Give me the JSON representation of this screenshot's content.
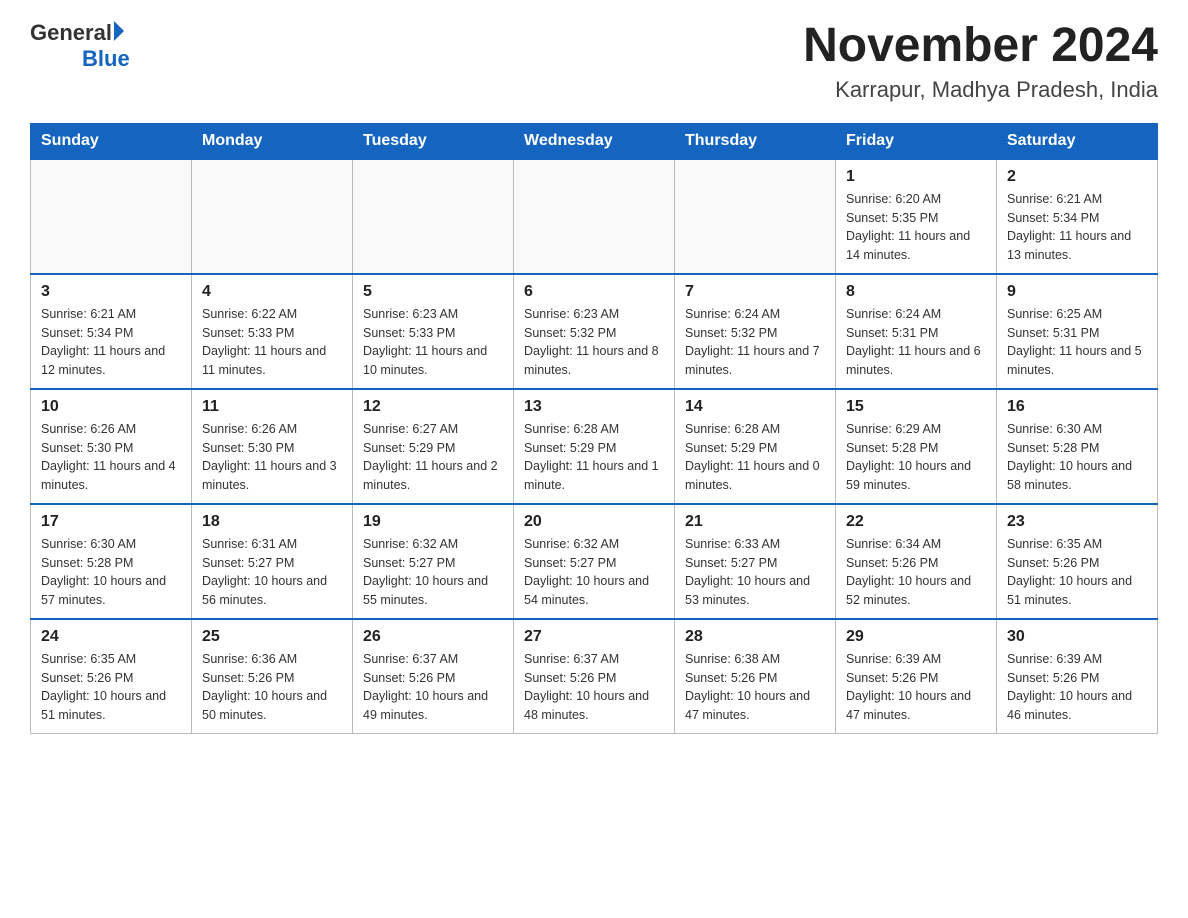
{
  "header": {
    "logo_general": "General",
    "logo_blue": "Blue",
    "month_title": "November 2024",
    "location": "Karrapur, Madhya Pradesh, India"
  },
  "days_of_week": [
    "Sunday",
    "Monday",
    "Tuesday",
    "Wednesday",
    "Thursday",
    "Friday",
    "Saturday"
  ],
  "weeks": [
    [
      {
        "day": "",
        "info": ""
      },
      {
        "day": "",
        "info": ""
      },
      {
        "day": "",
        "info": ""
      },
      {
        "day": "",
        "info": ""
      },
      {
        "day": "",
        "info": ""
      },
      {
        "day": "1",
        "info": "Sunrise: 6:20 AM\nSunset: 5:35 PM\nDaylight: 11 hours and 14 minutes."
      },
      {
        "day": "2",
        "info": "Sunrise: 6:21 AM\nSunset: 5:34 PM\nDaylight: 11 hours and 13 minutes."
      }
    ],
    [
      {
        "day": "3",
        "info": "Sunrise: 6:21 AM\nSunset: 5:34 PM\nDaylight: 11 hours and 12 minutes."
      },
      {
        "day": "4",
        "info": "Sunrise: 6:22 AM\nSunset: 5:33 PM\nDaylight: 11 hours and 11 minutes."
      },
      {
        "day": "5",
        "info": "Sunrise: 6:23 AM\nSunset: 5:33 PM\nDaylight: 11 hours and 10 minutes."
      },
      {
        "day": "6",
        "info": "Sunrise: 6:23 AM\nSunset: 5:32 PM\nDaylight: 11 hours and 8 minutes."
      },
      {
        "day": "7",
        "info": "Sunrise: 6:24 AM\nSunset: 5:32 PM\nDaylight: 11 hours and 7 minutes."
      },
      {
        "day": "8",
        "info": "Sunrise: 6:24 AM\nSunset: 5:31 PM\nDaylight: 11 hours and 6 minutes."
      },
      {
        "day": "9",
        "info": "Sunrise: 6:25 AM\nSunset: 5:31 PM\nDaylight: 11 hours and 5 minutes."
      }
    ],
    [
      {
        "day": "10",
        "info": "Sunrise: 6:26 AM\nSunset: 5:30 PM\nDaylight: 11 hours and 4 minutes."
      },
      {
        "day": "11",
        "info": "Sunrise: 6:26 AM\nSunset: 5:30 PM\nDaylight: 11 hours and 3 minutes."
      },
      {
        "day": "12",
        "info": "Sunrise: 6:27 AM\nSunset: 5:29 PM\nDaylight: 11 hours and 2 minutes."
      },
      {
        "day": "13",
        "info": "Sunrise: 6:28 AM\nSunset: 5:29 PM\nDaylight: 11 hours and 1 minute."
      },
      {
        "day": "14",
        "info": "Sunrise: 6:28 AM\nSunset: 5:29 PM\nDaylight: 11 hours and 0 minutes."
      },
      {
        "day": "15",
        "info": "Sunrise: 6:29 AM\nSunset: 5:28 PM\nDaylight: 10 hours and 59 minutes."
      },
      {
        "day": "16",
        "info": "Sunrise: 6:30 AM\nSunset: 5:28 PM\nDaylight: 10 hours and 58 minutes."
      }
    ],
    [
      {
        "day": "17",
        "info": "Sunrise: 6:30 AM\nSunset: 5:28 PM\nDaylight: 10 hours and 57 minutes."
      },
      {
        "day": "18",
        "info": "Sunrise: 6:31 AM\nSunset: 5:27 PM\nDaylight: 10 hours and 56 minutes."
      },
      {
        "day": "19",
        "info": "Sunrise: 6:32 AM\nSunset: 5:27 PM\nDaylight: 10 hours and 55 minutes."
      },
      {
        "day": "20",
        "info": "Sunrise: 6:32 AM\nSunset: 5:27 PM\nDaylight: 10 hours and 54 minutes."
      },
      {
        "day": "21",
        "info": "Sunrise: 6:33 AM\nSunset: 5:27 PM\nDaylight: 10 hours and 53 minutes."
      },
      {
        "day": "22",
        "info": "Sunrise: 6:34 AM\nSunset: 5:26 PM\nDaylight: 10 hours and 52 minutes."
      },
      {
        "day": "23",
        "info": "Sunrise: 6:35 AM\nSunset: 5:26 PM\nDaylight: 10 hours and 51 minutes."
      }
    ],
    [
      {
        "day": "24",
        "info": "Sunrise: 6:35 AM\nSunset: 5:26 PM\nDaylight: 10 hours and 51 minutes."
      },
      {
        "day": "25",
        "info": "Sunrise: 6:36 AM\nSunset: 5:26 PM\nDaylight: 10 hours and 50 minutes."
      },
      {
        "day": "26",
        "info": "Sunrise: 6:37 AM\nSunset: 5:26 PM\nDaylight: 10 hours and 49 minutes."
      },
      {
        "day": "27",
        "info": "Sunrise: 6:37 AM\nSunset: 5:26 PM\nDaylight: 10 hours and 48 minutes."
      },
      {
        "day": "28",
        "info": "Sunrise: 6:38 AM\nSunset: 5:26 PM\nDaylight: 10 hours and 47 minutes."
      },
      {
        "day": "29",
        "info": "Sunrise: 6:39 AM\nSunset: 5:26 PM\nDaylight: 10 hours and 47 minutes."
      },
      {
        "day": "30",
        "info": "Sunrise: 6:39 AM\nSunset: 5:26 PM\nDaylight: 10 hours and 46 minutes."
      }
    ]
  ]
}
